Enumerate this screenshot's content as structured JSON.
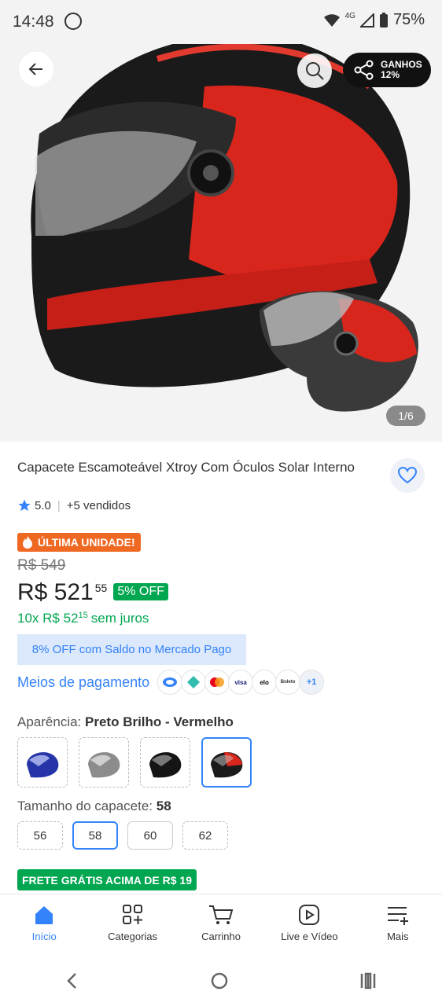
{
  "status": {
    "time": "14:48",
    "network": "4G",
    "battery": "75%"
  },
  "hero": {
    "counter": "1/6",
    "share": {
      "line1": "GANHOS",
      "line2": "12%"
    }
  },
  "product": {
    "title": "Capacete Escamoteável Xtroy Com Óculos Solar Interno",
    "rating": "5.0",
    "sold": "+5 vendidos",
    "badge": "ÚLTIMA UNIDADE!",
    "old_price": "R$ 549",
    "price_main": "R$ 521",
    "price_cents": "55",
    "discount": "5% OFF",
    "installments_prefix": "10x R$ 52",
    "installments_cents": "15",
    "installments_suffix": "sem juros",
    "saldo": "8% OFF com Saldo no Mercado Pago",
    "payment_label": "Meios de pagamento",
    "payment_icons": [
      "visa",
      "elo",
      "Boleto"
    ],
    "payment_more": "+1"
  },
  "appearance": {
    "label": "Aparência:",
    "value": "Preto Brilho - Vermelho",
    "selected_index": 3
  },
  "size": {
    "label": "Tamanho do capacete:",
    "value": "58",
    "options": [
      "56",
      "58",
      "60",
      "62"
    ],
    "selected_index": 1
  },
  "shipping": "FRETE GRÁTIS ACIMA DE R$ 19",
  "nav": {
    "items": [
      {
        "label": "Início",
        "icon": "home-icon"
      },
      {
        "label": "Categorias",
        "icon": "categories-icon"
      },
      {
        "label": "Carrinho",
        "icon": "cart-icon"
      },
      {
        "label": "Live e Vídeo",
        "icon": "play-icon"
      },
      {
        "label": "Mais",
        "icon": "menu-plus-icon"
      }
    ]
  },
  "colors": {
    "accent": "#3483fa",
    "green": "#00a650",
    "orange": "#f06923"
  }
}
